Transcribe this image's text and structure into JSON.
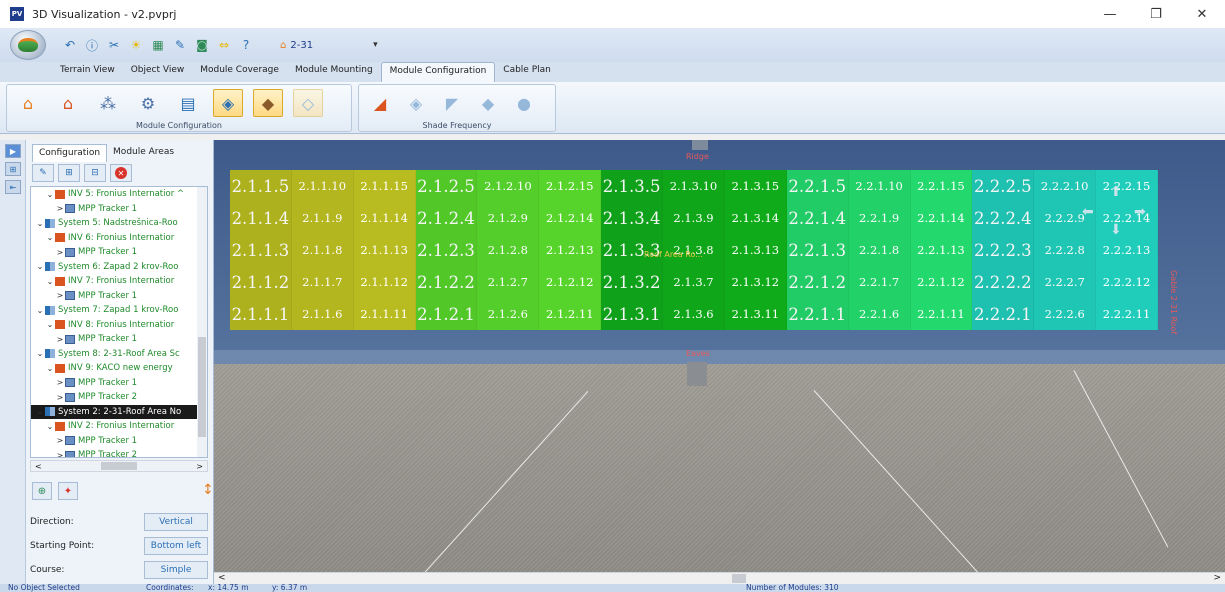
{
  "window": {
    "title": "3D Visualization - v2.pvprj",
    "app_icon_text": "PV",
    "minimize": "—",
    "maximize": "❐",
    "close": "✕"
  },
  "quickbar": {
    "project_label": "2-31",
    "dropdown": "▾"
  },
  "tabs": [
    "Terrain View",
    "Object View",
    "Module Coverage",
    "Module Mounting",
    "Module Configuration",
    "Cable Plan"
  ],
  "active_tab": "Module Configuration",
  "ribbon": {
    "group1_label": "Module Configuration",
    "group2_label": "Shade Frequency"
  },
  "left_panel": {
    "tabs": [
      "Configuration",
      "Module Areas"
    ],
    "tree": [
      {
        "indent": 2,
        "chev": "⌄",
        "icon": "inv",
        "label": "INV 5: Fronius Internatior ^",
        "green": true
      },
      {
        "indent": 3,
        "chev": ">",
        "icon": "mpp",
        "label": "MPP Tracker 1",
        "green": true
      },
      {
        "indent": 1,
        "chev": "⌄",
        "icon": "sys",
        "label": "System 5:  Nadstrešnica-Roo",
        "green": true
      },
      {
        "indent": 2,
        "chev": "⌄",
        "icon": "inv",
        "label": "INV 6: Fronius Internatior",
        "green": true
      },
      {
        "indent": 3,
        "chev": ">",
        "icon": "mpp",
        "label": "MPP Tracker 1",
        "green": true
      },
      {
        "indent": 1,
        "chev": "⌄",
        "icon": "sys",
        "label": "System 6:  Zapad 2 krov-Roo",
        "green": true
      },
      {
        "indent": 2,
        "chev": "⌄",
        "icon": "inv",
        "label": "INV 7: Fronius Internatior",
        "green": true
      },
      {
        "indent": 3,
        "chev": ">",
        "icon": "mpp",
        "label": "MPP Tracker 1",
        "green": true
      },
      {
        "indent": 1,
        "chev": "⌄",
        "icon": "sys",
        "label": "System 7:  Zapad 1 krov-Roo",
        "green": true
      },
      {
        "indent": 2,
        "chev": "⌄",
        "icon": "inv",
        "label": "INV 8: Fronius Internatior",
        "green": true
      },
      {
        "indent": 3,
        "chev": ">",
        "icon": "mpp",
        "label": "MPP Tracker 1",
        "green": true
      },
      {
        "indent": 1,
        "chev": "⌄",
        "icon": "sys",
        "label": "System 8:  2-31-Roof Area Sc",
        "green": true
      },
      {
        "indent": 2,
        "chev": "⌄",
        "icon": "inv",
        "label": "INV 9: KACO new energy",
        "green": true
      },
      {
        "indent": 3,
        "chev": ">",
        "icon": "mpp",
        "label": "MPP Tracker 1",
        "green": true
      },
      {
        "indent": 3,
        "chev": ">",
        "icon": "mpp",
        "label": "MPP Tracker 2",
        "green": true
      },
      {
        "indent": 1,
        "chev": "⌄",
        "icon": "sys",
        "label": "System 2:  2-31-Roof Area No",
        "selected": true
      },
      {
        "indent": 2,
        "chev": "⌄",
        "icon": "inv",
        "label": "INV 2: Fronius Internatior",
        "green": true
      },
      {
        "indent": 3,
        "chev": ">",
        "icon": "mpp",
        "label": "MPP Tracker 1",
        "green": true
      },
      {
        "indent": 3,
        "chev": ">",
        "icon": "mpp",
        "label": "MPP Tracker 2",
        "green": true
      }
    ],
    "scroll_left": "<",
    "scroll_right": ">",
    "properties": {
      "direction_label": "Direction:",
      "direction_value": "Vertical",
      "start_label": "Starting Point:",
      "start_value": "Bottom left",
      "course_label": "Course:",
      "course_value": "Simple"
    }
  },
  "viewport": {
    "ridge_label": "Ridge",
    "eaves_label": "Eaves",
    "roof_label": "Roof Area Ro...",
    "side_label": "Gable 2-31 Roof",
    "modules": [
      [
        "2.1.1.5",
        "2.1.1.10",
        "2.1.1.15",
        "2.1.2.5",
        "2.1.2.10",
        "2.1.2.15",
        "2.1.3.5",
        "2.1.3.10",
        "2.1.3.15",
        "2.2.1.5",
        "2.2.1.10",
        "2.2.1.15",
        "2.2.2.5",
        "2.2.2.10",
        "2.2.2.15"
      ],
      [
        "2.1.1.4",
        "2.1.1.9",
        "2.1.1.14",
        "2.1.2.4",
        "2.1.2.9",
        "2.1.2.14",
        "2.1.3.4",
        "2.1.3.9",
        "2.1.3.14",
        "2.2.1.4",
        "2.2.1.9",
        "2.2.1.14",
        "2.2.2.4",
        "2.2.2.9",
        "2.2.2.14"
      ],
      [
        "2.1.1.3",
        "2.1.1.8",
        "2.1.1.13",
        "2.1.2.3",
        "2.1.2.8",
        "2.1.2.13",
        "2.1.3.3",
        "2.1.3.8",
        "2.1.3.13",
        "2.2.1.3",
        "2.2.1.8",
        "2.2.1.13",
        "2.2.2.3",
        "2.2.2.8",
        "2.2.2.13"
      ],
      [
        "2.1.1.2",
        "2.1.1.7",
        "2.1.1.12",
        "2.1.2.2",
        "2.1.2.7",
        "2.1.2.12",
        "2.1.3.2",
        "2.1.3.7",
        "2.1.3.12",
        "2.2.1.2",
        "2.2.1.7",
        "2.2.1.12",
        "2.2.2.2",
        "2.2.2.7",
        "2.2.2.12"
      ],
      [
        "2.1.1.1",
        "2.1.1.6",
        "2.1.1.11",
        "2.1.2.1",
        "2.1.2.6",
        "2.1.2.11",
        "2.1.3.1",
        "2.1.3.6",
        "2.1.3.11",
        "2.2.1.1",
        "2.2.1.6",
        "2.2.1.11",
        "2.2.2.1",
        "2.2.2.6",
        "2.2.2.11"
      ]
    ],
    "group_colors": [
      "#b5b81f",
      "#55d02a",
      "#10a81a",
      "#22d46a",
      "#1fc8b6"
    ]
  },
  "status": {
    "selection": "No Object Selected",
    "coords_label": "Coordinates:",
    "x": "x: 14.75 m",
    "y": "y: 6.37 m",
    "modules": "Number of Modules: 310"
  }
}
